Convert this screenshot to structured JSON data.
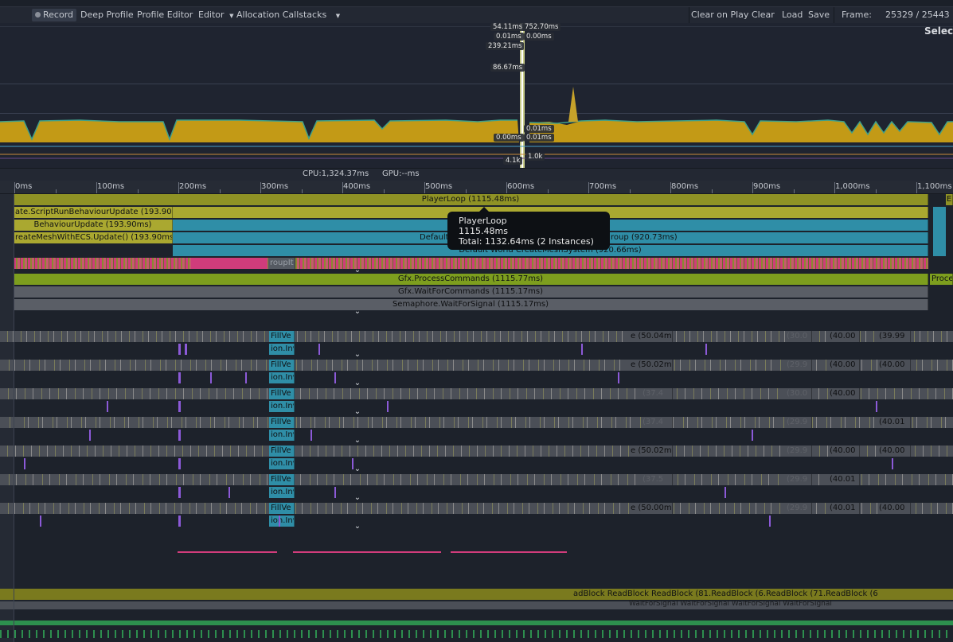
{
  "toolbar": {
    "record": "Record",
    "deep_profile": "Deep Profile",
    "profile_editor": "Profile Editor",
    "editor": "Editor",
    "allocation_callstacks": "Allocation Callstacks",
    "clear_on_play": "Clear on Play",
    "clear": "Clear",
    "load": "Load",
    "save": "Save",
    "frame_label": "Frame:",
    "frame_value": "25329 / 25443"
  },
  "graph": {
    "select_text": "Selec",
    "labels": [
      "54.11ms",
      "752.70ms",
      "0.01ms",
      "0.00ms",
      "239.21ms",
      "86.67ms",
      "0.01ms",
      "0.00ms",
      "0.01ms",
      "4.1k",
      "1.0k"
    ]
  },
  "status": {
    "cpu": "CPU:1,324.37ms",
    "gpu": "GPU:--ms"
  },
  "ruler": {
    "ticks": [
      "0ms",
      "100ms",
      "200ms",
      "300ms",
      "400ms",
      "500ms",
      "600ms",
      "700ms",
      "800ms",
      "900ms",
      "1,000ms",
      "1,100ms"
    ]
  },
  "main_thread": {
    "player_loop": "PlayerLoop (1115.48ms)",
    "script_run": "ate.ScriptRunBehaviourUpdate (193.90",
    "behaviour_update": "BehaviourUpdate (193.90ms)",
    "create_mesh": "reateMeshWithECS.Update() (193.90ms",
    "default_world": "Default World",
    "group": "roup (920.73ms)",
    "default_world_create": "Default World CreateMeshSystem (920.66ms)",
    "group_it": "roupIt",
    "right_e": "E"
  },
  "render_thread": {
    "process_commands": "Gfx.ProcessCommands (1115.77ms)",
    "wait_for_commands": "Gfx.WaitForCommands (1115.17ms)",
    "semaphore": "Semaphore.WaitForSignal (1115.17ms)",
    "right_proce": "Proce"
  },
  "tooltip": {
    "line1": "PlayerLoop",
    "line2": "1115.48ms",
    "line3": "Total: 1132.64ms (2 Instances)"
  },
  "workers": [
    {
      "fill": "FillVe",
      "inv": "ion.Inv",
      "a": "e (50.04m",
      "b": "(30.0",
      "c": "(40.00",
      "d": "(39.99"
    },
    {
      "fill": "FillVe",
      "inv": "ion.Inv",
      "a": "e (50.02m",
      "b": "(29.9",
      "c": "(40.00",
      "d": "(40.00"
    },
    {
      "fill": "FillVe",
      "inv": "ion.Inv",
      "a": "(37.4",
      "b": "(30.0",
      "c": "(40.00",
      "d": ""
    },
    {
      "fill": "FillVe",
      "inv": "ion.Inv",
      "a": "(37.4",
      "b": "(29.9",
      "c": "",
      "d": "(40.01"
    },
    {
      "fill": "FillVe",
      "inv": "ion.Inv",
      "a": "e (50.02m",
      "b": "(29.9",
      "c": "(40.00",
      "d": "(40.00"
    },
    {
      "fill": "FillVe",
      "inv": "ion.Inv",
      "a": "(37.5",
      "b": "(29.9",
      "c": "(40.01",
      "d": ""
    },
    {
      "fill": "FillVe",
      "inv": "ion.Inv",
      "a": "e (50.00m",
      "b": "(29.9",
      "c": "(40.01",
      "d": "(40.00"
    }
  ],
  "bottom": {
    "readblock": "adBlock  ReadBlock  ReadBlock (81.ReadBlock (6.ReadBlock (71.ReadBlock (6",
    "waitsignal": "WaitForSignal  WaitForSignal  WaitForSignal  WaitForSignal"
  },
  "colors": {
    "playerloop": "#8f9225",
    "script": "#aaa830",
    "behaviour": "#2f8ea7",
    "editor_pink": "#d03c7b",
    "gfx": "#7d9e1e",
    "gray": "#5a5e66",
    "tooltip_bg": "#0d1014"
  }
}
